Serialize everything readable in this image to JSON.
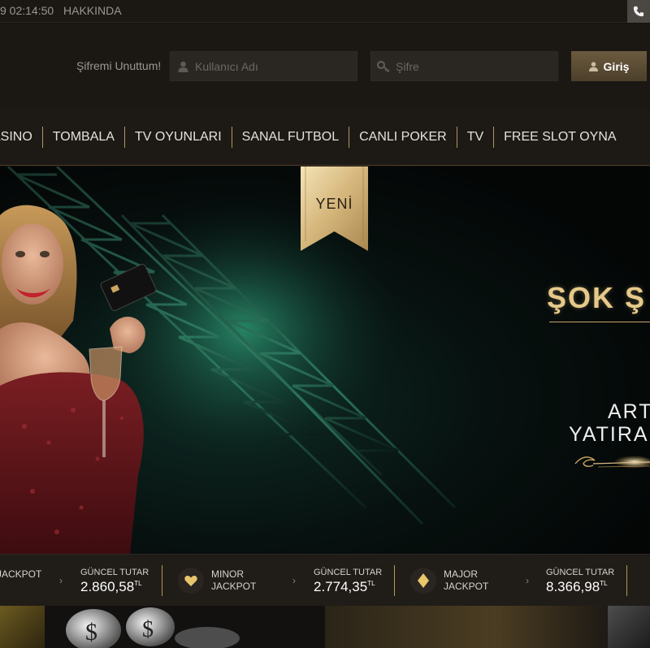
{
  "topbar": {
    "time": "9 02:14:50",
    "about": "HAKKINDA",
    "phone_icon": "phone-icon"
  },
  "login": {
    "forgot": "Şifremi Unuttum!",
    "username_placeholder": "Kullanıcı Adı",
    "password_placeholder": "Şifre",
    "login_label": "Giriş"
  },
  "nav": {
    "items": [
      "ASINO",
      "TOMBALA",
      "TV OYUNLARI",
      "SANAL FUTBOL",
      "CANLI POKER",
      "TV",
      "FREE SLOT OYNA"
    ]
  },
  "banner": {
    "ribbon": "YENİ",
    "title": "ŞOK Ş",
    "line1": "ART",
    "line2": "YATIRA"
  },
  "jackpots": [
    {
      "name_line1": "",
      "name_line2": "JACKPOT",
      "label": "GÜNCEL TUTAR",
      "value": "2.860,58",
      "currency": "TL",
      "icon": ""
    },
    {
      "name_line1": "MINOR",
      "name_line2": "JACKPOT",
      "label": "GÜNCEL TUTAR",
      "value": "2.774,35",
      "currency": "TL",
      "icon": "heart-icon"
    },
    {
      "name_line1": "MAJOR",
      "name_line2": "JACKPOT",
      "label": "GÜNCEL TUTAR",
      "value": "8.366,98",
      "currency": "TL",
      "icon": "diamond-icon"
    }
  ],
  "colors": {
    "gold": "#c7a76a",
    "bg": "#15120f",
    "nav_bg": "#1d1915"
  }
}
